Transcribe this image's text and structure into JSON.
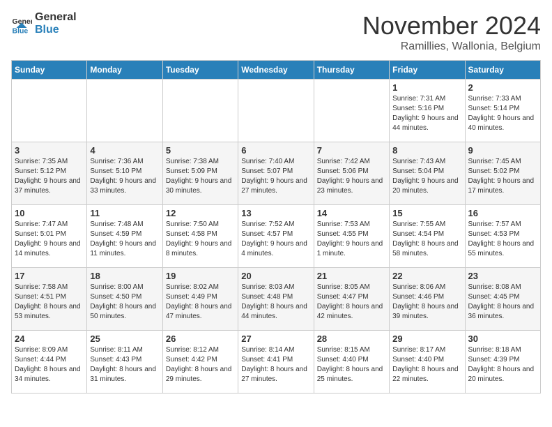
{
  "logo": {
    "text_general": "General",
    "text_blue": "Blue"
  },
  "header": {
    "month": "November 2024",
    "location": "Ramillies, Wallonia, Belgium"
  },
  "weekdays": [
    "Sunday",
    "Monday",
    "Tuesday",
    "Wednesday",
    "Thursday",
    "Friday",
    "Saturday"
  ],
  "weeks": [
    [
      {
        "day": "",
        "info": ""
      },
      {
        "day": "",
        "info": ""
      },
      {
        "day": "",
        "info": ""
      },
      {
        "day": "",
        "info": ""
      },
      {
        "day": "",
        "info": ""
      },
      {
        "day": "1",
        "info": "Sunrise: 7:31 AM\nSunset: 5:16 PM\nDaylight: 9 hours and 44 minutes."
      },
      {
        "day": "2",
        "info": "Sunrise: 7:33 AM\nSunset: 5:14 PM\nDaylight: 9 hours and 40 minutes."
      }
    ],
    [
      {
        "day": "3",
        "info": "Sunrise: 7:35 AM\nSunset: 5:12 PM\nDaylight: 9 hours and 37 minutes."
      },
      {
        "day": "4",
        "info": "Sunrise: 7:36 AM\nSunset: 5:10 PM\nDaylight: 9 hours and 33 minutes."
      },
      {
        "day": "5",
        "info": "Sunrise: 7:38 AM\nSunset: 5:09 PM\nDaylight: 9 hours and 30 minutes."
      },
      {
        "day": "6",
        "info": "Sunrise: 7:40 AM\nSunset: 5:07 PM\nDaylight: 9 hours and 27 minutes."
      },
      {
        "day": "7",
        "info": "Sunrise: 7:42 AM\nSunset: 5:06 PM\nDaylight: 9 hours and 23 minutes."
      },
      {
        "day": "8",
        "info": "Sunrise: 7:43 AM\nSunset: 5:04 PM\nDaylight: 9 hours and 20 minutes."
      },
      {
        "day": "9",
        "info": "Sunrise: 7:45 AM\nSunset: 5:02 PM\nDaylight: 9 hours and 17 minutes."
      }
    ],
    [
      {
        "day": "10",
        "info": "Sunrise: 7:47 AM\nSunset: 5:01 PM\nDaylight: 9 hours and 14 minutes."
      },
      {
        "day": "11",
        "info": "Sunrise: 7:48 AM\nSunset: 4:59 PM\nDaylight: 9 hours and 11 minutes."
      },
      {
        "day": "12",
        "info": "Sunrise: 7:50 AM\nSunset: 4:58 PM\nDaylight: 9 hours and 8 minutes."
      },
      {
        "day": "13",
        "info": "Sunrise: 7:52 AM\nSunset: 4:57 PM\nDaylight: 9 hours and 4 minutes."
      },
      {
        "day": "14",
        "info": "Sunrise: 7:53 AM\nSunset: 4:55 PM\nDaylight: 9 hours and 1 minute."
      },
      {
        "day": "15",
        "info": "Sunrise: 7:55 AM\nSunset: 4:54 PM\nDaylight: 8 hours and 58 minutes."
      },
      {
        "day": "16",
        "info": "Sunrise: 7:57 AM\nSunset: 4:53 PM\nDaylight: 8 hours and 55 minutes."
      }
    ],
    [
      {
        "day": "17",
        "info": "Sunrise: 7:58 AM\nSunset: 4:51 PM\nDaylight: 8 hours and 53 minutes."
      },
      {
        "day": "18",
        "info": "Sunrise: 8:00 AM\nSunset: 4:50 PM\nDaylight: 8 hours and 50 minutes."
      },
      {
        "day": "19",
        "info": "Sunrise: 8:02 AM\nSunset: 4:49 PM\nDaylight: 8 hours and 47 minutes."
      },
      {
        "day": "20",
        "info": "Sunrise: 8:03 AM\nSunset: 4:48 PM\nDaylight: 8 hours and 44 minutes."
      },
      {
        "day": "21",
        "info": "Sunrise: 8:05 AM\nSunset: 4:47 PM\nDaylight: 8 hours and 42 minutes."
      },
      {
        "day": "22",
        "info": "Sunrise: 8:06 AM\nSunset: 4:46 PM\nDaylight: 8 hours and 39 minutes."
      },
      {
        "day": "23",
        "info": "Sunrise: 8:08 AM\nSunset: 4:45 PM\nDaylight: 8 hours and 36 minutes."
      }
    ],
    [
      {
        "day": "24",
        "info": "Sunrise: 8:09 AM\nSunset: 4:44 PM\nDaylight: 8 hours and 34 minutes."
      },
      {
        "day": "25",
        "info": "Sunrise: 8:11 AM\nSunset: 4:43 PM\nDaylight: 8 hours and 31 minutes."
      },
      {
        "day": "26",
        "info": "Sunrise: 8:12 AM\nSunset: 4:42 PM\nDaylight: 8 hours and 29 minutes."
      },
      {
        "day": "27",
        "info": "Sunrise: 8:14 AM\nSunset: 4:41 PM\nDaylight: 8 hours and 27 minutes."
      },
      {
        "day": "28",
        "info": "Sunrise: 8:15 AM\nSunset: 4:40 PM\nDaylight: 8 hours and 25 minutes."
      },
      {
        "day": "29",
        "info": "Sunrise: 8:17 AM\nSunset: 4:40 PM\nDaylight: 8 hours and 22 minutes."
      },
      {
        "day": "30",
        "info": "Sunrise: 8:18 AM\nSunset: 4:39 PM\nDaylight: 8 hours and 20 minutes."
      }
    ]
  ]
}
